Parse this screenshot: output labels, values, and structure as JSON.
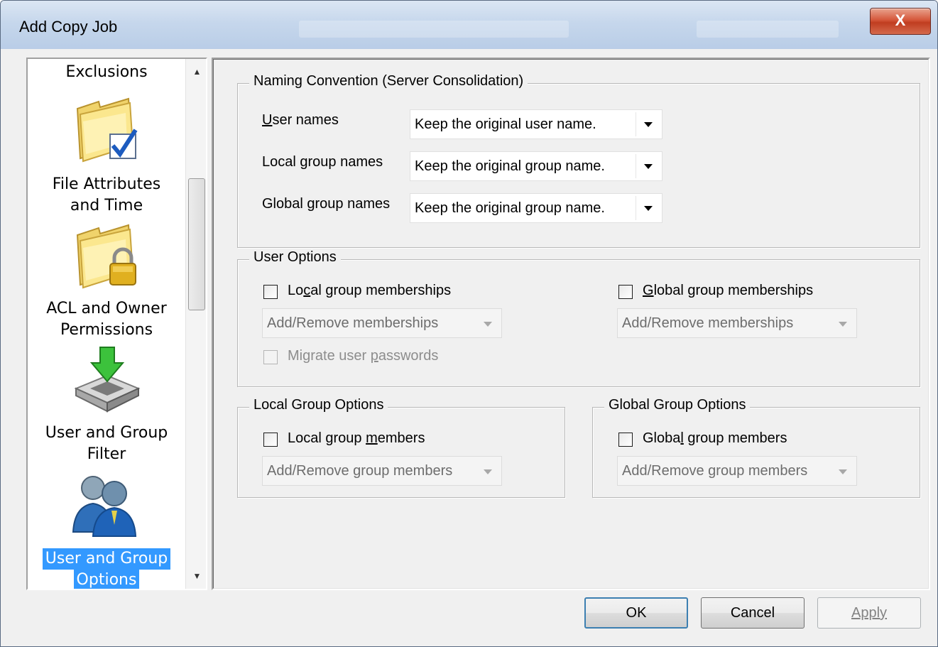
{
  "window": {
    "title": "Add Copy Job",
    "close_glyph": "X"
  },
  "nav": {
    "items": [
      {
        "label": "Exclusions",
        "icon": "exclusions-icon",
        "selected": false
      },
      {
        "label_line1": "File Attributes",
        "label_line2": "and Time",
        "icon": "folder-checkmark-icon",
        "selected": false
      },
      {
        "label_line1": "ACL and Owner",
        "label_line2": "Permissions",
        "icon": "folder-lock-icon",
        "selected": false
      },
      {
        "label_line1": "User and Group",
        "label_line2": "Filter",
        "icon": "filter-tray-arrow-icon",
        "selected": false
      },
      {
        "label_line1": "User and Group",
        "label_line2": "Options",
        "icon": "users-icon",
        "selected": true
      }
    ],
    "scroll_up": "▲",
    "scroll_down": "▼"
  },
  "naming": {
    "legend": "Naming Convention (Server Consolidation)",
    "user_names_label_u": "U",
    "user_names_label_rest": "ser names",
    "user_names_value": "Keep the original user name.",
    "local_group_label": "Local group names",
    "local_group_value": "Keep the original group name.",
    "global_group_label": "Global group names",
    "global_group_value": "Keep the original group name."
  },
  "user_options": {
    "legend": "User Options",
    "local_memberships_pre": "Lo",
    "local_memberships_u": "c",
    "local_memberships_post": "al group memberships",
    "local_memberships_checked": false,
    "local_memberships_value": "Add/Remove memberships",
    "global_memberships_u": "G",
    "global_memberships_post": "lobal group memberships",
    "global_memberships_checked": false,
    "global_memberships_value": "Add/Remove memberships",
    "migrate_passwords_pre": "Migrate user ",
    "migrate_passwords_u": "p",
    "migrate_passwords_post": "asswords",
    "migrate_passwords_checked": false
  },
  "local_group_options": {
    "legend": "Local Group Options",
    "members_pre": "Local group ",
    "members_u": "m",
    "members_post": "embers",
    "members_checked": false,
    "members_value": "Add/Remove group members"
  },
  "global_group_options": {
    "legend": "Global Group Options",
    "members_pre": "Globa",
    "members_u": "l",
    "members_post": " group members",
    "members_checked": false,
    "members_value": "Add/Remove group members"
  },
  "buttons": {
    "ok": "OK",
    "cancel": "Cancel",
    "apply": "Apply"
  },
  "colors": {
    "selection": "#3399ff",
    "close_button": "#c9452a",
    "title_gradient": "#c6d7ec"
  }
}
